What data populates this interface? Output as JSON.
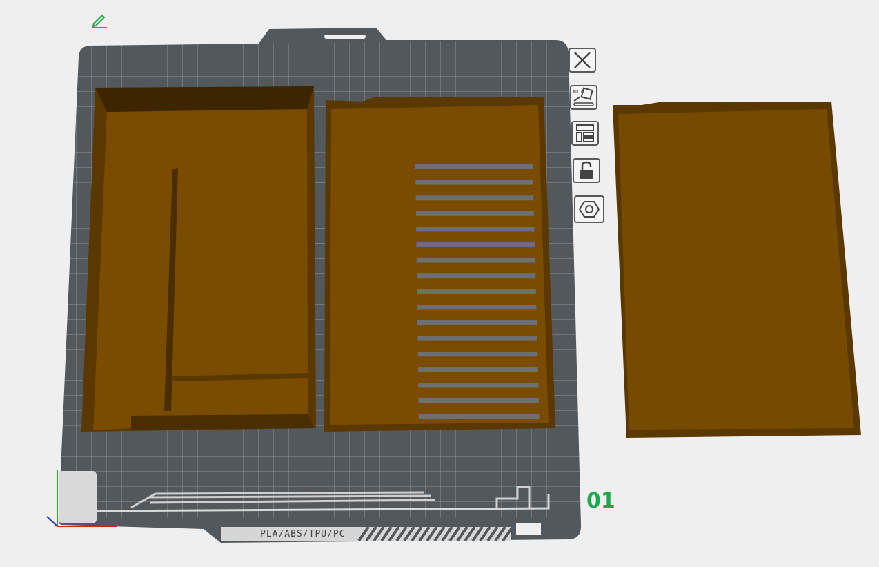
{
  "plate": {
    "number": "01",
    "filament_label": "PLA/ABS/TPU/PC"
  },
  "toolbar": [
    {
      "name": "close-plate-icon",
      "label": "Remove plate"
    },
    {
      "name": "auto-orient-icon",
      "label": "Auto orient"
    },
    {
      "name": "arrange-icon",
      "label": "Arrange"
    },
    {
      "name": "lock-icon",
      "label": "Lock plate"
    },
    {
      "name": "plate-settings-icon",
      "label": "Plate settings"
    }
  ],
  "colors": {
    "background": "#efefef",
    "plate": "#53585c",
    "grid": "#7b8185",
    "model": "#6e4500",
    "model_edge": "#4a2e00",
    "accent": "#1aa84a"
  }
}
